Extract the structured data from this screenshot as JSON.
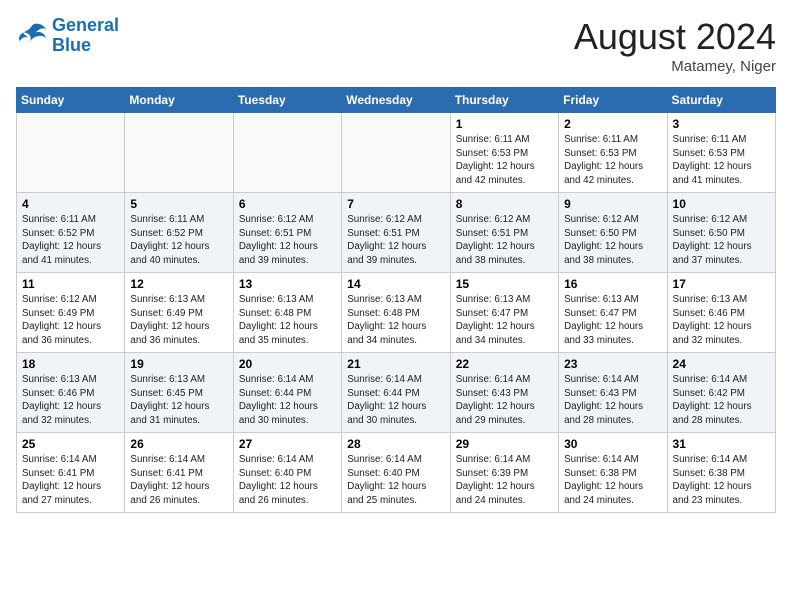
{
  "logo": {
    "line1": "General",
    "line2": "Blue"
  },
  "title": "August 2024",
  "location": "Matamey, Niger",
  "days_of_week": [
    "Sunday",
    "Monday",
    "Tuesday",
    "Wednesday",
    "Thursday",
    "Friday",
    "Saturday"
  ],
  "weeks": [
    [
      {
        "day": "",
        "info": ""
      },
      {
        "day": "",
        "info": ""
      },
      {
        "day": "",
        "info": ""
      },
      {
        "day": "",
        "info": ""
      },
      {
        "day": "1",
        "info": "Sunrise: 6:11 AM\nSunset: 6:53 PM\nDaylight: 12 hours\nand 42 minutes."
      },
      {
        "day": "2",
        "info": "Sunrise: 6:11 AM\nSunset: 6:53 PM\nDaylight: 12 hours\nand 42 minutes."
      },
      {
        "day": "3",
        "info": "Sunrise: 6:11 AM\nSunset: 6:53 PM\nDaylight: 12 hours\nand 41 minutes."
      }
    ],
    [
      {
        "day": "4",
        "info": "Sunrise: 6:11 AM\nSunset: 6:52 PM\nDaylight: 12 hours\nand 41 minutes."
      },
      {
        "day": "5",
        "info": "Sunrise: 6:11 AM\nSunset: 6:52 PM\nDaylight: 12 hours\nand 40 minutes."
      },
      {
        "day": "6",
        "info": "Sunrise: 6:12 AM\nSunset: 6:51 PM\nDaylight: 12 hours\nand 39 minutes."
      },
      {
        "day": "7",
        "info": "Sunrise: 6:12 AM\nSunset: 6:51 PM\nDaylight: 12 hours\nand 39 minutes."
      },
      {
        "day": "8",
        "info": "Sunrise: 6:12 AM\nSunset: 6:51 PM\nDaylight: 12 hours\nand 38 minutes."
      },
      {
        "day": "9",
        "info": "Sunrise: 6:12 AM\nSunset: 6:50 PM\nDaylight: 12 hours\nand 38 minutes."
      },
      {
        "day": "10",
        "info": "Sunrise: 6:12 AM\nSunset: 6:50 PM\nDaylight: 12 hours\nand 37 minutes."
      }
    ],
    [
      {
        "day": "11",
        "info": "Sunrise: 6:12 AM\nSunset: 6:49 PM\nDaylight: 12 hours\nand 36 minutes."
      },
      {
        "day": "12",
        "info": "Sunrise: 6:13 AM\nSunset: 6:49 PM\nDaylight: 12 hours\nand 36 minutes."
      },
      {
        "day": "13",
        "info": "Sunrise: 6:13 AM\nSunset: 6:48 PM\nDaylight: 12 hours\nand 35 minutes."
      },
      {
        "day": "14",
        "info": "Sunrise: 6:13 AM\nSunset: 6:48 PM\nDaylight: 12 hours\nand 34 minutes."
      },
      {
        "day": "15",
        "info": "Sunrise: 6:13 AM\nSunset: 6:47 PM\nDaylight: 12 hours\nand 34 minutes."
      },
      {
        "day": "16",
        "info": "Sunrise: 6:13 AM\nSunset: 6:47 PM\nDaylight: 12 hours\nand 33 minutes."
      },
      {
        "day": "17",
        "info": "Sunrise: 6:13 AM\nSunset: 6:46 PM\nDaylight: 12 hours\nand 32 minutes."
      }
    ],
    [
      {
        "day": "18",
        "info": "Sunrise: 6:13 AM\nSunset: 6:46 PM\nDaylight: 12 hours\nand 32 minutes."
      },
      {
        "day": "19",
        "info": "Sunrise: 6:13 AM\nSunset: 6:45 PM\nDaylight: 12 hours\nand 31 minutes."
      },
      {
        "day": "20",
        "info": "Sunrise: 6:14 AM\nSunset: 6:44 PM\nDaylight: 12 hours\nand 30 minutes."
      },
      {
        "day": "21",
        "info": "Sunrise: 6:14 AM\nSunset: 6:44 PM\nDaylight: 12 hours\nand 30 minutes."
      },
      {
        "day": "22",
        "info": "Sunrise: 6:14 AM\nSunset: 6:43 PM\nDaylight: 12 hours\nand 29 minutes."
      },
      {
        "day": "23",
        "info": "Sunrise: 6:14 AM\nSunset: 6:43 PM\nDaylight: 12 hours\nand 28 minutes."
      },
      {
        "day": "24",
        "info": "Sunrise: 6:14 AM\nSunset: 6:42 PM\nDaylight: 12 hours\nand 28 minutes."
      }
    ],
    [
      {
        "day": "25",
        "info": "Sunrise: 6:14 AM\nSunset: 6:41 PM\nDaylight: 12 hours\nand 27 minutes."
      },
      {
        "day": "26",
        "info": "Sunrise: 6:14 AM\nSunset: 6:41 PM\nDaylight: 12 hours\nand 26 minutes."
      },
      {
        "day": "27",
        "info": "Sunrise: 6:14 AM\nSunset: 6:40 PM\nDaylight: 12 hours\nand 26 minutes."
      },
      {
        "day": "28",
        "info": "Sunrise: 6:14 AM\nSunset: 6:40 PM\nDaylight: 12 hours\nand 25 minutes."
      },
      {
        "day": "29",
        "info": "Sunrise: 6:14 AM\nSunset: 6:39 PM\nDaylight: 12 hours\nand 24 minutes."
      },
      {
        "day": "30",
        "info": "Sunrise: 6:14 AM\nSunset: 6:38 PM\nDaylight: 12 hours\nand 24 minutes."
      },
      {
        "day": "31",
        "info": "Sunrise: 6:14 AM\nSunset: 6:38 PM\nDaylight: 12 hours\nand 23 minutes."
      }
    ]
  ]
}
